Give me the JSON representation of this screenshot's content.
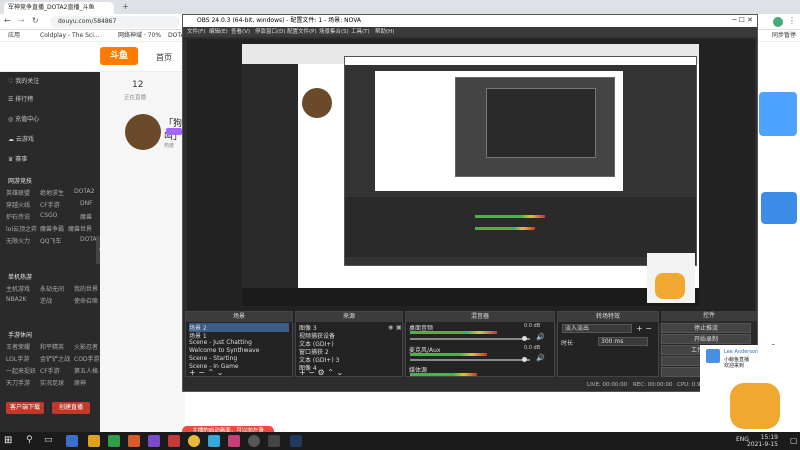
{
  "browser": {
    "tabs": [
      {
        "label": "军神竞争直播_DOTA2直播_斗鱼"
      },
      {
        "label": "OBS 24.0.3 (64-bit, windows)"
      }
    ],
    "url": "douyu.com/584867",
    "bookmarks": [
      "应用",
      "Coldplay - The Sci...",
      "网络神域 · 70%",
      "DOTA2"
    ],
    "profile": "同步暂停"
  },
  "douyu": {
    "logo": "斗鱼",
    "nav_home": "首页",
    "sidebar": {
      "items": [
        "我的关注",
        "排行榜",
        "充值中心",
        "云游戏",
        "赛事"
      ],
      "section_games": "网游竞技",
      "games": [
        "英雄联盟",
        "绝地求生",
        "DOTA2",
        "穿越火线",
        "CF手游",
        "DNF",
        "炉石传说",
        "CSGO",
        "魔兽",
        "lol云顶之弈",
        "魔兽争霸",
        "魔兽世界",
        "无限火力",
        "QQ飞车",
        "DOTA"
      ],
      "section_single": "单机热游",
      "singles": [
        "主机游戏",
        "永劫无间",
        "我的世界",
        "NBA2K",
        "逆战",
        "使命召唤"
      ],
      "section_mobile": "手游休闲",
      "mobiles": [
        "王者荣耀",
        "和平精英",
        "火影忍者",
        "LOL手游",
        "金铲铲之战",
        "COD手游",
        "一起来捉妖",
        "CF手游",
        "第五人格",
        "天刀手游",
        "实况足球",
        "原神"
      ],
      "btn_left": "客户端下载",
      "btn_right": "创建直播"
    },
    "follow_count": "12",
    "follow_label": "正在直播",
    "room_title": "「狗叫」",
    "room_sub": "热度",
    "notice": "主播的启动画面，可以向左滑"
  },
  "obs": {
    "title": "OBS 24.0.3 (64-bit, windows) - 配置文件: 1 - 场景: NOVA",
    "menu": [
      "文件(F)",
      "编辑(E)",
      "查看(V)",
      "停靠窗口(D)",
      "配置文件(P)",
      "场景集合(S)",
      "工具(T)",
      "帮助(H)"
    ],
    "docks": {
      "scenes": "场景",
      "sources": "来源",
      "mixer": "混音器",
      "transitions": "转场特效",
      "controls": "控件"
    },
    "scenes": [
      "场景 2",
      "场景 1",
      "Scene - Just Chatting",
      "Welcome to Synthwave",
      "Scene - Starting",
      "Scene - In Game"
    ],
    "sources": [
      "图像 3",
      "视频捕获设备",
      "文本 (GDI+)",
      "窗口捕获 2",
      "文本 (GDI+) 3",
      "图像 4"
    ],
    "mixer": [
      {
        "name": "桌面音频",
        "level": 0.62,
        "vol": "0.0 dB"
      },
      {
        "name": "麦克风/Aux",
        "level": 0.55,
        "vol": "0.0 dB"
      },
      {
        "name": "媒体源",
        "level": 0.48,
        "vol": "0.0 dB"
      }
    ],
    "transition": "淡入淡出",
    "transition_duration": "时长",
    "transition_ms": "300 ms",
    "controls": [
      "停止推流",
      "开始录制",
      "工作室模式",
      "设置",
      "退出"
    ],
    "status": {
      "live": "LIVE: 00:00:00",
      "rec": "REC: 00:00:00",
      "cpu": "CPU: 0.9%, 30.00 fps"
    }
  },
  "chat": {
    "user": "Lee Anderson",
    "lines": [
      "小鲸鱼直播",
      "欢迎来到"
    ]
  },
  "taskbar": {
    "lang": "ENG",
    "time": "15:19",
    "date": "2021-9-15"
  }
}
